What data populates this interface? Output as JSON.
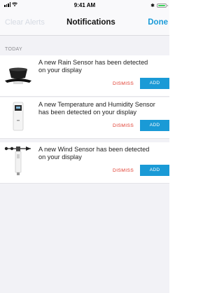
{
  "status_bar": {
    "time": "9:41 AM",
    "bluetooth": "✱"
  },
  "nav": {
    "left": "Clear Alerts",
    "title": "Notifications",
    "right": "Done"
  },
  "section": {
    "header": "TODAY"
  },
  "notifications": [
    {
      "message_line1": "A new Rain Sensor has been detected",
      "message_line2": "on your display",
      "dismiss": "DISMISS",
      "add": "ADD",
      "icon": "rain-sensor-icon"
    },
    {
      "message_line1": "A new Temperature and Humidity Sensor",
      "message_line2": "has been detected on your display",
      "dismiss": "DISMISS",
      "add": "ADD",
      "icon": "thermo-hygro-sensor-icon"
    },
    {
      "message_line1": "A new Wind Sensor has been detected",
      "message_line2": "on your display",
      "dismiss": "DISMISS",
      "add": "ADD",
      "icon": "wind-sensor-icon"
    }
  ],
  "colors": {
    "accent": "#1b9bd8",
    "add_button": "#1a9ad6",
    "dismiss": "#e0392c",
    "background": "#f2f2f6"
  }
}
